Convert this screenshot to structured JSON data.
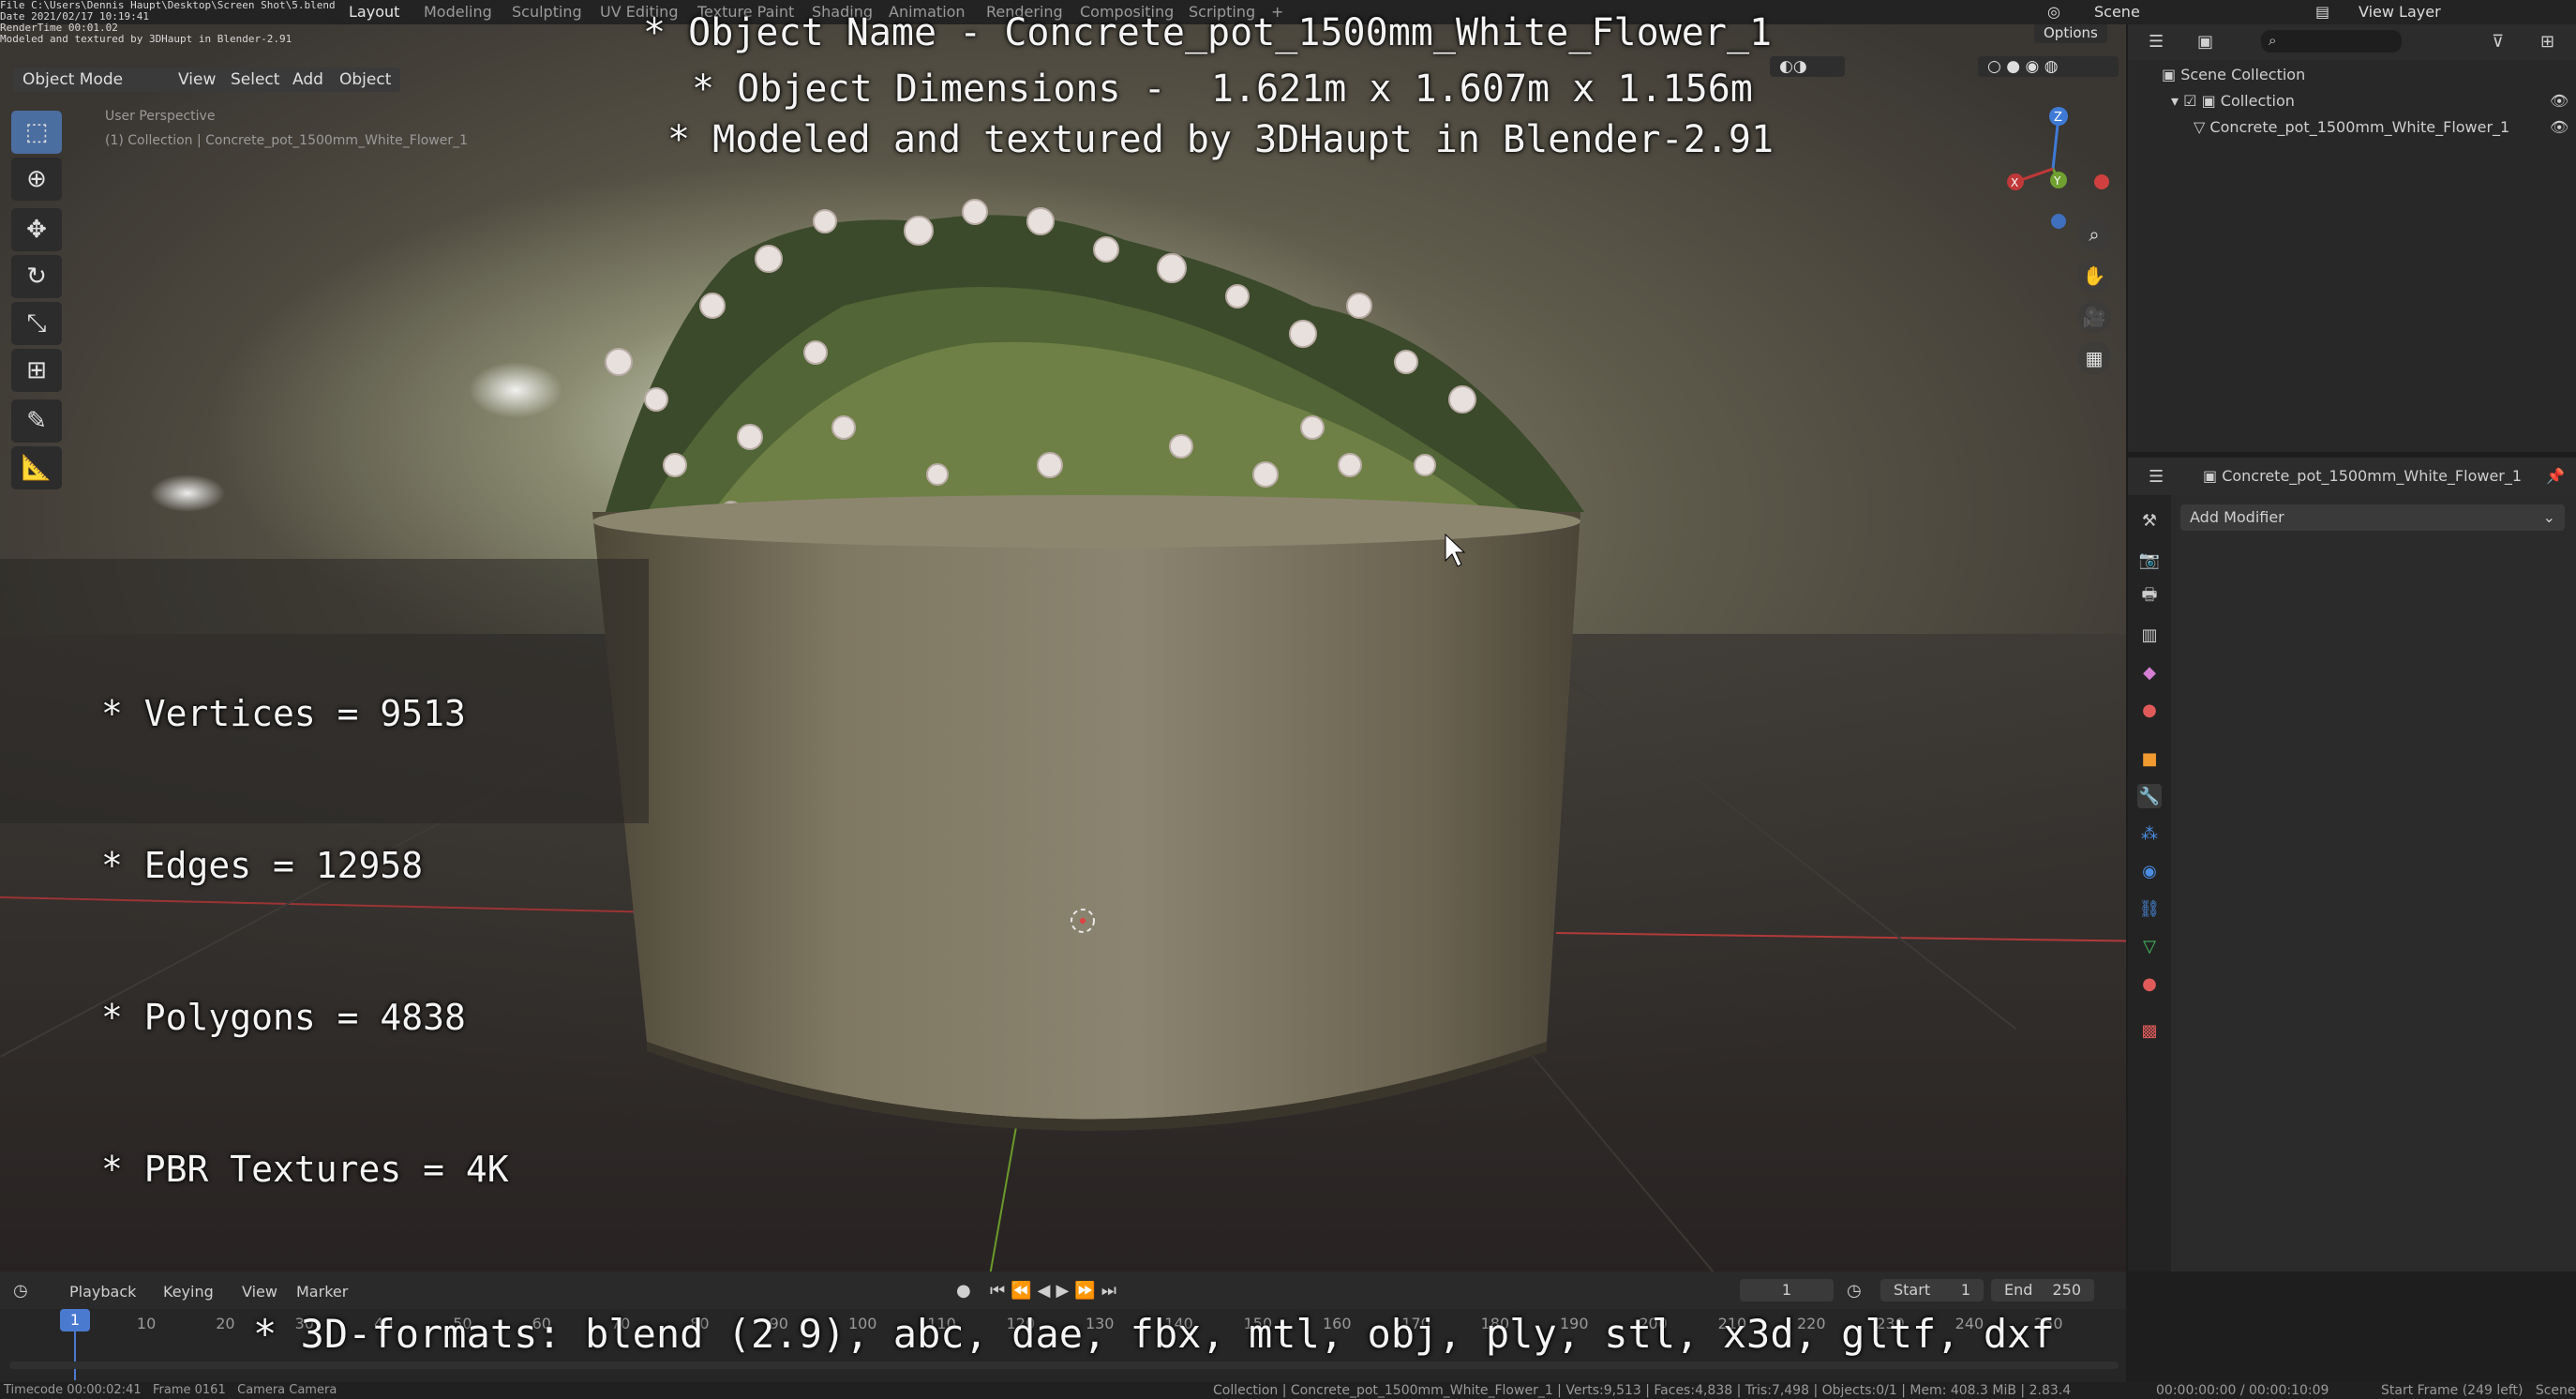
{
  "topbar": {
    "file_lines": [
      "File C:\\Users\\Dennis Haupt\\Desktop\\Screen Shot\\5.blend",
      "Date 2021/02/17 10:19:41",
      "RenderTime 00:01.02",
      "Modeled and textured by 3DHaupt in Blender-2.91"
    ],
    "workspaces": [
      "Layout",
      "Modeling",
      "Sculpting",
      "UV Editing",
      "Texture Paint",
      "Shading",
      "Animation",
      "Rendering",
      "Compositing",
      "Scripting"
    ],
    "active_workspace": "Layout",
    "add_tab": "+",
    "scene_label": "Scene",
    "view_layer_label": "View Layer"
  },
  "viewport": {
    "mode_label": "Object Mode",
    "menu": [
      "View",
      "Select",
      "Add",
      "Object"
    ],
    "options_label": "Options",
    "perspective_text": "User Perspective",
    "collection_text": "(1) Collection | Concrete_pot_1500mm_White_Flower_1",
    "gizmo_axes": [
      "Z",
      "Y",
      "X"
    ]
  },
  "overlay": {
    "title_lines": [
      "* Object Name - Concrete_pot_1500mm_White_Flower_1",
      "* Object Dimensions -  1.621m x 1.607m x 1.156m",
      "* Modeled and textured by 3DHaupt in Blender-2.91"
    ],
    "stats": [
      "* Vertices = 9513",
      "* Edges = 12958",
      "* Polygons = 4838",
      "* PBR Textures = 4K"
    ],
    "formats": "* 3D-formats: blend (2.9), abc, dae, fbx, mtl, obj, ply, stl, x3d, gltf, dxf"
  },
  "outliner": {
    "scene_collection": "Scene Collection",
    "collection": "Collection",
    "object": "Concrete_pot_1500mm_White_Flower_1"
  },
  "properties": {
    "object_name": "Concrete_pot_1500mm_White_Flower_1",
    "add_modifier": "Add Modifier"
  },
  "timeline": {
    "menu": [
      "Playback",
      "Keying",
      "View",
      "Marker"
    ],
    "current_frame": "1",
    "start_label": "Start",
    "start_value": "1",
    "end_label": "End",
    "end_value": "250",
    "ticks": [
      "1",
      "10",
      "20",
      "30",
      "40",
      "50",
      "60",
      "70",
      "80",
      "90",
      "100",
      "110",
      "120",
      "130",
      "140",
      "150",
      "160",
      "170",
      "180",
      "190",
      "200",
      "210",
      "220",
      "230",
      "240",
      "250"
    ]
  },
  "statusbar": {
    "left": "Timecode 00:00:02:41   Frame 0161   Camera Camera",
    "center": "Collection | Concrete_pot_1500mm_White_Flower_1 | Verts:9,513 | Faces:4,838 | Tris:7,498 | Objects:0/1 | Mem: 408.3 MiB | 2.83.4",
    "timecode": "00:00:00:00 / 00:00:10:09",
    "right": "Start Frame (249 left)   Scene Scene"
  }
}
